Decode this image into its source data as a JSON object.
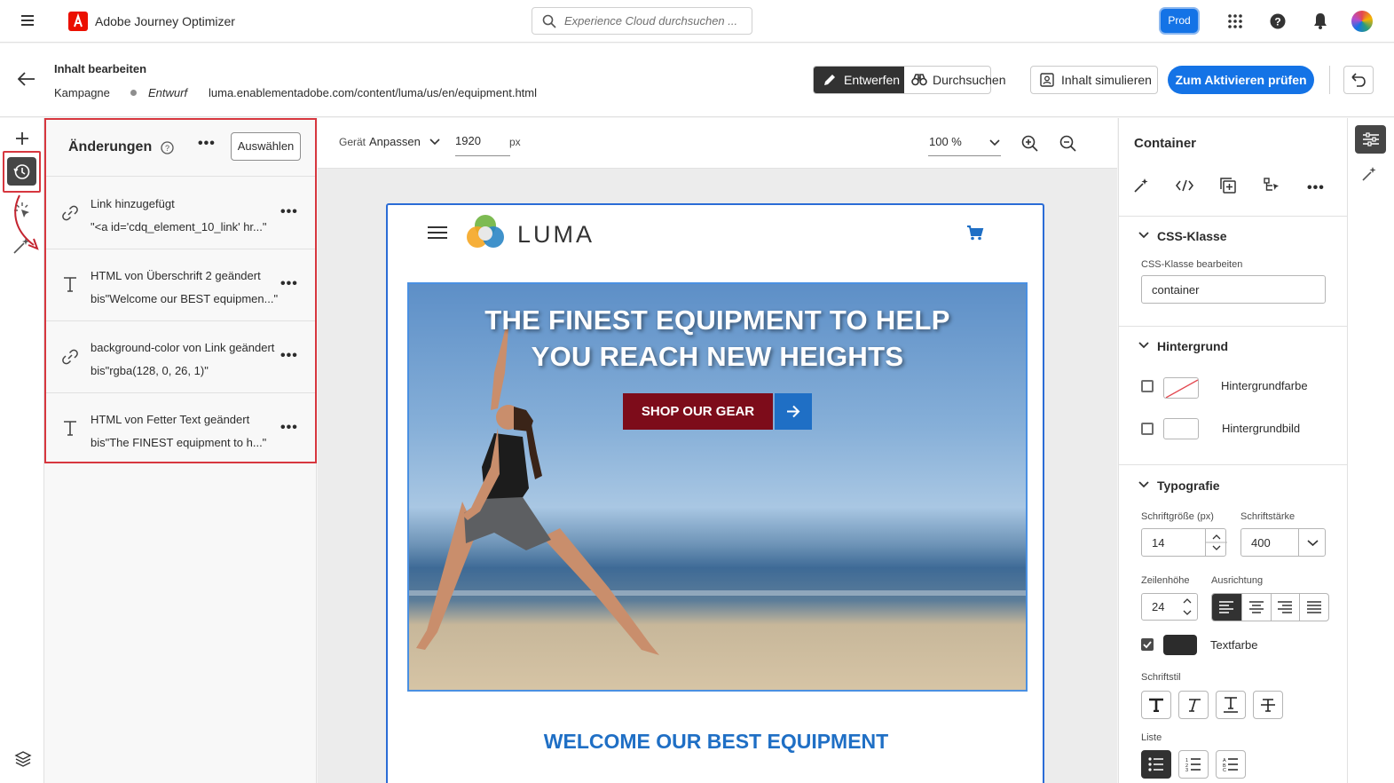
{
  "topbar": {
    "app_title": "Adobe Journey Optimizer",
    "search_placeholder": "Experience Cloud durchsuchen ...",
    "env_badge": "Prod"
  },
  "header": {
    "title": "Inhalt bearbeiten",
    "type": "Kampagne",
    "status": "Entwurf",
    "url": "luma.enablementadobe.com/content/luma/us/en/equipment.html",
    "design_label": "Entwerfen",
    "browse_label": "Durchsuchen",
    "simulate_label": "Inhalt simulieren",
    "activate_label": "Zum Aktivieren prüfen"
  },
  "changes": {
    "title": "Änderungen",
    "select_label": "Auswählen",
    "items": [
      {
        "icon": "link-icon",
        "line1": "Link hinzugefügt",
        "line2": "\"<a id='cdq_element_10_link' hr...\""
      },
      {
        "icon": "text-icon",
        "line1": "HTML von Überschrift 2 geändert",
        "line2": "bis\"Welcome our BEST equipmen...\""
      },
      {
        "icon": "link-icon",
        "line1": "background-color von Link geändert",
        "line2": "bis\"rgba(128, 0, 26, 1)\""
      },
      {
        "icon": "text-icon",
        "line1": "HTML von Fetter Text geändert",
        "line2": "bis\"The FINEST equipment to h...\""
      }
    ]
  },
  "canvas_toolbar": {
    "device_label": "Gerät",
    "device_value": "Anpassen",
    "width_value": "1920",
    "width_unit": "px",
    "zoom_value": "100 %"
  },
  "preview": {
    "brand": "LUMA",
    "hero_line1": "THE FINEST EQUIPMENT TO HELP",
    "hero_line2": "YOU REACH NEW HEIGHTS",
    "cta": "SHOP OUR GEAR",
    "welcome": "WELCOME OUR BEST EQUIPMENT"
  },
  "properties": {
    "title": "Container",
    "css_section": "CSS-Klasse",
    "css_edit_label": "CSS-Klasse bearbeiten",
    "css_value": "container",
    "bg_section": "Hintergrund",
    "bg_color_label": "Hintergrundfarbe",
    "bg_image_label": "Hintergrundbild",
    "typo_section": "Typografie",
    "font_size_label": "Schriftgröße (px)",
    "font_size_value": "14",
    "font_weight_label": "Schriftstärke",
    "font_weight_value": "400",
    "line_height_label": "Zeilenhöhe",
    "line_height_value": "24",
    "align_label": "Ausrichtung",
    "text_color_label": "Textfarbe",
    "font_style_label": "Schriftstil",
    "list_label": "Liste",
    "text_color": "#2c2c2c"
  },
  "colors": {
    "accent_blue": "#1473e6",
    "highlight_red": "#d7373f",
    "cta_dark_red": "#7d0c1a",
    "luma_blue": "#1f6fc5"
  }
}
